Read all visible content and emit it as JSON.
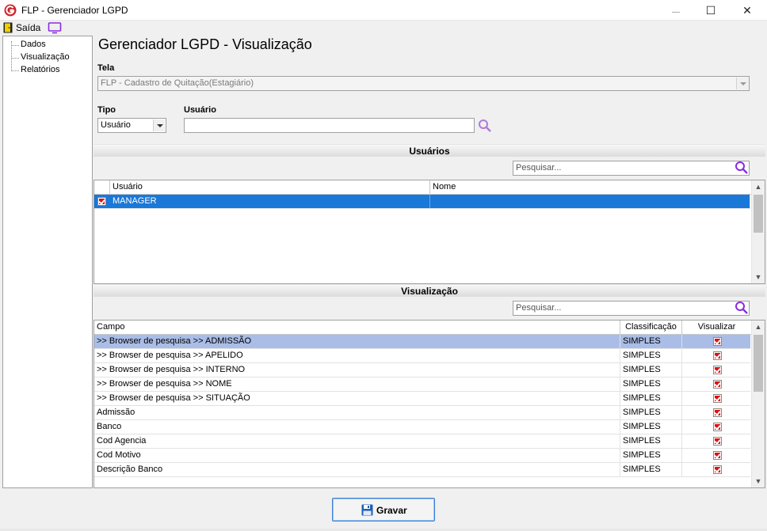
{
  "window": {
    "title": "FLP - Gerenciador LGPD",
    "minimize": "—",
    "maximize": "☐",
    "close": "✕"
  },
  "toolbar": {
    "exit_label": "Saída"
  },
  "sidebar": {
    "items": [
      {
        "label": "Dados"
      },
      {
        "label": "Visualização"
      },
      {
        "label": "Relatórios"
      }
    ]
  },
  "main": {
    "title": "Gerenciador LGPD - Visualização",
    "tela_label": "Tela",
    "tela_value": "FLP - Cadastro de Quitação(Estagiário)",
    "tipo_label": "Tipo",
    "tipo_value": "Usuário",
    "usuario_label": "Usuário",
    "usuario_value": ""
  },
  "users_section": {
    "title": "Usuários",
    "search_placeholder": "Pesquisar...",
    "columns": [
      "Usuário",
      "Nome"
    ],
    "rows": [
      {
        "usuario": "MANAGER",
        "nome": "",
        "checked": true
      }
    ]
  },
  "view_section": {
    "title": "Visualização",
    "search_placeholder": "Pesquisar...",
    "columns": [
      "Campo",
      "Classificação",
      "Visualizar"
    ],
    "rows": [
      {
        "campo": ">> Browser de pesquisa >> ADMISSÃO",
        "classificacao": "SIMPLES",
        "visualizar": true
      },
      {
        "campo": ">> Browser de pesquisa >> APELIDO",
        "classificacao": "SIMPLES",
        "visualizar": true
      },
      {
        "campo": ">> Browser de pesquisa >> INTERNO",
        "classificacao": "SIMPLES",
        "visualizar": true
      },
      {
        "campo": ">> Browser de pesquisa >> NOME",
        "classificacao": "SIMPLES",
        "visualizar": true
      },
      {
        "campo": ">> Browser de pesquisa >> SITUAÇÃO",
        "classificacao": "SIMPLES",
        "visualizar": true
      },
      {
        "campo": "Admissão",
        "classificacao": "SIMPLES",
        "visualizar": true
      },
      {
        "campo": "Banco",
        "classificacao": "SIMPLES",
        "visualizar": true
      },
      {
        "campo": "Cod Agencia",
        "classificacao": "SIMPLES",
        "visualizar": true
      },
      {
        "campo": "Cod Motivo",
        "classificacao": "SIMPLES",
        "visualizar": true
      },
      {
        "campo": "Descrição Banco",
        "classificacao": "SIMPLES",
        "visualizar": true
      }
    ]
  },
  "footer": {
    "save_label": "Gravar"
  },
  "colors": {
    "selection_blue": "#1a78d8",
    "selection_light": "#a9bde6",
    "accent_purple": "#8a2be2",
    "check_red": "#e01010"
  }
}
